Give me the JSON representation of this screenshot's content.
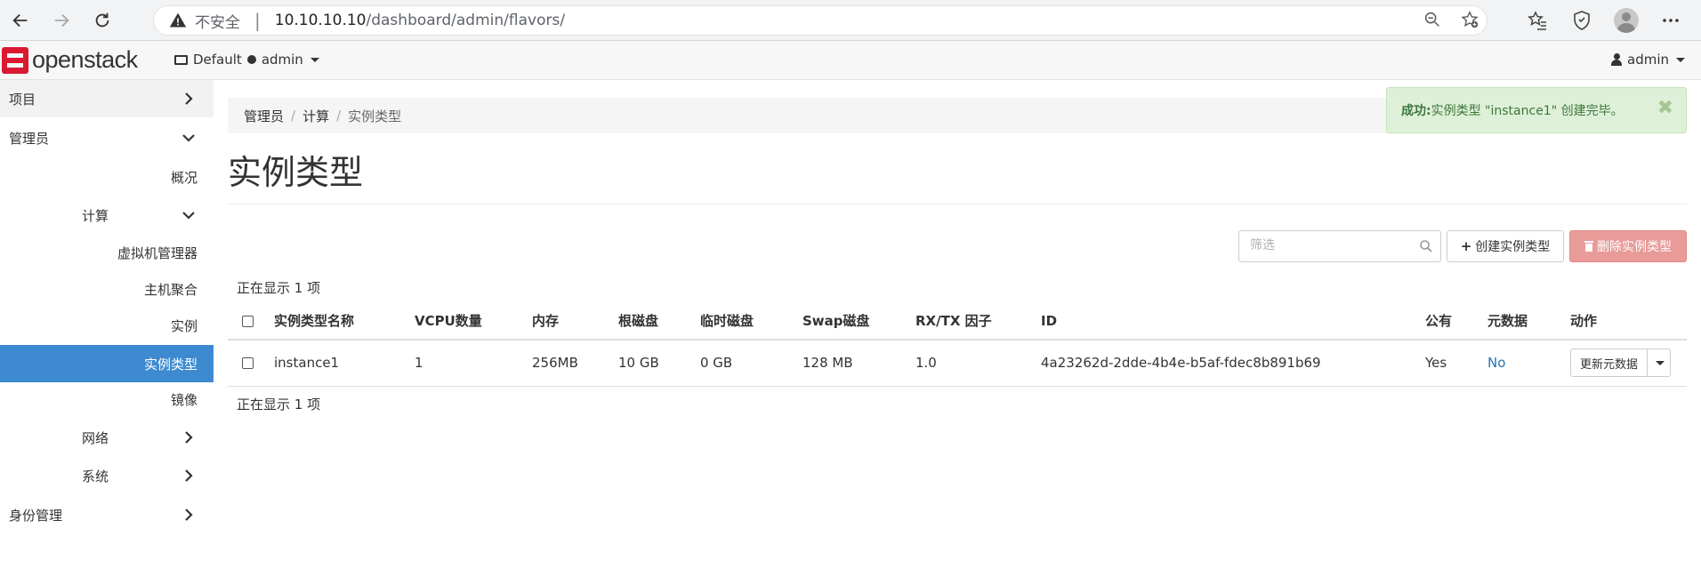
{
  "browser": {
    "insecure_label": "不安全",
    "separator": "|",
    "url_host": "10.10.10.10",
    "url_path": "/dashboard/admin/flavors/"
  },
  "topnav": {
    "logo_text": "openstack",
    "project_domain": "Default",
    "project_name": "admin",
    "user_name": "admin"
  },
  "sidebar": {
    "items": [
      {
        "label": "项目"
      },
      {
        "label": "管理员"
      },
      {
        "label": "概况"
      },
      {
        "label": "计算"
      },
      {
        "label": "虚拟机管理器"
      },
      {
        "label": "主机聚合"
      },
      {
        "label": "实例"
      },
      {
        "label": "实例类型"
      },
      {
        "label": "镜像"
      },
      {
        "label": "网络"
      },
      {
        "label": "系统"
      },
      {
        "label": "身份管理"
      }
    ]
  },
  "breadcrumb": {
    "items": [
      "管理员",
      "计算",
      "实例类型"
    ],
    "separator": "/"
  },
  "page": {
    "title": "实例类型",
    "filter_placeholder": "筛选",
    "create_button": "创建实例类型",
    "delete_button": "删除实例类型",
    "count_top": "正在显示 1 项",
    "count_bottom": "正在显示 1 项"
  },
  "table": {
    "headers": [
      "实例类型名称",
      "VCPU数量",
      "内存",
      "根磁盘",
      "临时磁盘",
      "Swap磁盘",
      "RX/TX 因子",
      "ID",
      "公有",
      "元数据",
      "动作"
    ],
    "rows": [
      {
        "name": "instance1",
        "vcpus": "1",
        "ram": "256MB",
        "root_disk": "10 GB",
        "ephemeral": "0 GB",
        "swap": "128 MB",
        "rxtx": "1.0",
        "id": "4a23262d-2dde-4b4e-b5af-fdec8b891b69",
        "public": "Yes",
        "metadata": "No",
        "action": "更新元数据"
      }
    ]
  },
  "alert": {
    "title": "成功:",
    "message": "实例类型 \"instance1\" 创建完毕。",
    "close": "✖"
  },
  "colors": {
    "accent": "#3d8ad0",
    "brand": "#da1a32",
    "danger_button": "#e89b98",
    "success_bg": "#dff0d8",
    "link": "#2a72b5"
  }
}
